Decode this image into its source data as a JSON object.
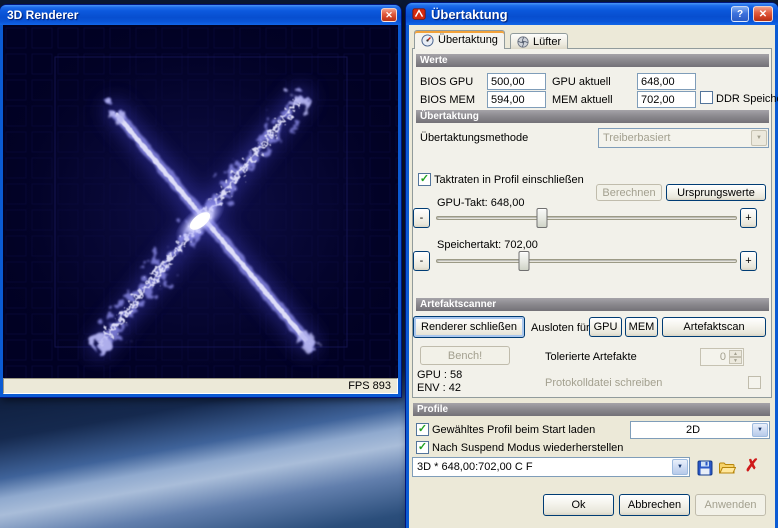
{
  "icons": {
    "close": "✕",
    "help": "?",
    "dropdown": "▼",
    "minus": "-",
    "plus": "+",
    "check": "✓",
    "delete": "✗",
    "spin_up": "▲",
    "spin_down": "▼"
  },
  "renderer": {
    "title": "3D Renderer",
    "fps": "FPS 893"
  },
  "dialog": {
    "title": "Übertaktung",
    "tabs": {
      "overclock": "Übertaktung",
      "fan": "Lüfter"
    },
    "werte": {
      "header": "Werte",
      "bios_gpu_label": "BIOS GPU",
      "bios_gpu_value": "500,00",
      "gpu_aktuell_label": "GPU aktuell",
      "gpu_aktuell_value": "648,00",
      "bios_mem_label": "BIOS MEM",
      "bios_mem_value": "594,00",
      "mem_aktuell_label": "MEM aktuell",
      "mem_aktuell_value": "702,00",
      "ddr_label": "DDR Speicher"
    },
    "overclock": {
      "header": "Übertaktung",
      "method_label": "Übertaktungsmethode",
      "method_value": "Treiberbasiert",
      "include_label": "Taktraten in Profil einschließen",
      "calc_label": "Berechnen",
      "origin_label": "Ursprungswerte",
      "gpu_slider_label": "GPU-Takt: 648,00",
      "gpu_slider_pos": "35%",
      "mem_slider_label": "Speichertakt: 702,00",
      "mem_slider_pos": "29%"
    },
    "scanner": {
      "header": "Artefaktscanner",
      "close_renderer_label": "Renderer schließen",
      "probe_label": "Ausloten für",
      "gpu_button": "GPU",
      "mem_button": "MEM",
      "scan_button": "Artefaktscan",
      "bench_label": "Bench!",
      "gpu_stat": "GPU : 58",
      "env_stat": "ENV : 42",
      "tolerated_label": "Tolerierte Artefakte",
      "tolerated_value": "0",
      "log_label": "Protokolldatei schreiben"
    },
    "profile": {
      "header": "Profile",
      "load_label": "Gewähltes Profil beim Start laden",
      "load_value": "2D",
      "suspend_label": "Nach Suspend Modus wiederherstellen",
      "current_profile": "3D * 648,00:702,00 C F"
    },
    "buttons": {
      "ok": "Ok",
      "cancel": "Abbrechen",
      "apply": "Anwenden"
    }
  }
}
